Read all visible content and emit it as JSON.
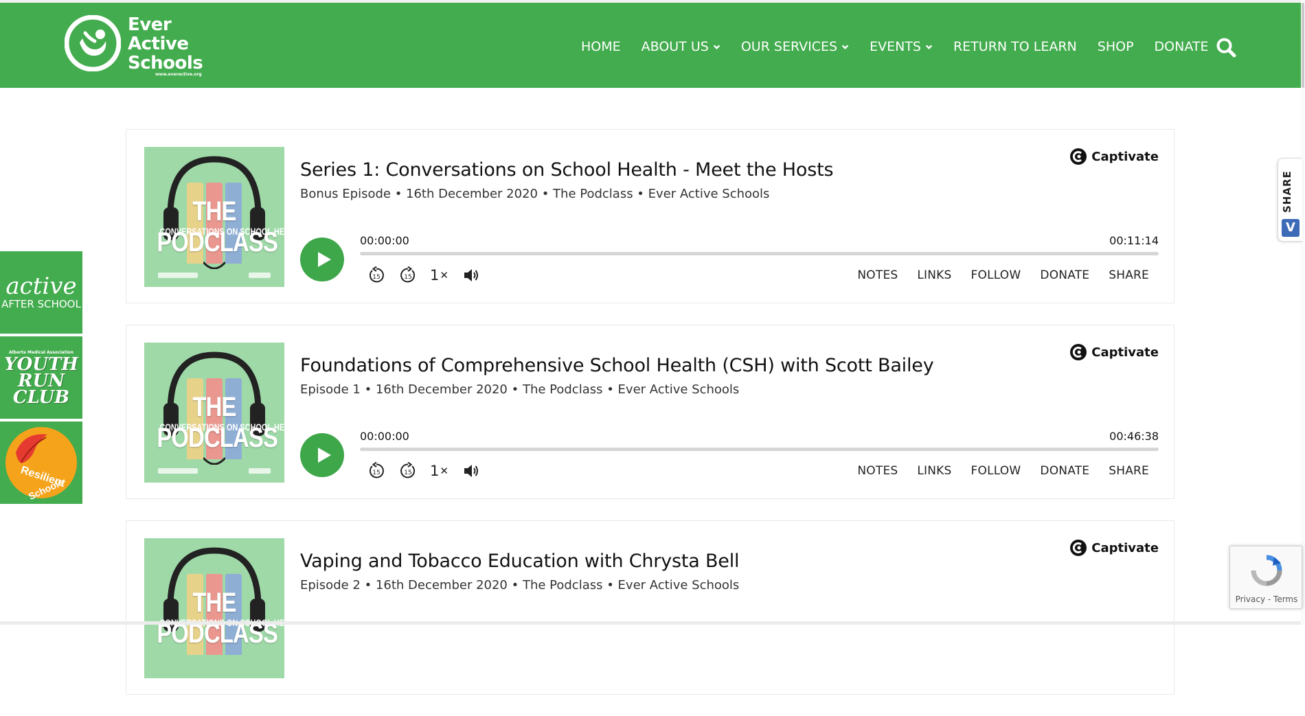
{
  "header": {
    "logo": {
      "line1": "Ever",
      "line2": "Active",
      "line3": "Schools",
      "ring_text": "Ever Active Schools",
      "url": "www.everactive.org"
    },
    "nav": [
      {
        "label": "HOME",
        "has_dropdown": false
      },
      {
        "label": "ABOUT US",
        "has_dropdown": true
      },
      {
        "label": "OUR SERVICES",
        "has_dropdown": true
      },
      {
        "label": "EVENTS",
        "has_dropdown": true
      },
      {
        "label": "RETURN TO LEARN",
        "has_dropdown": false
      },
      {
        "label": "SHOP",
        "has_dropdown": false
      },
      {
        "label": "DONATE",
        "has_dropdown": false
      }
    ],
    "search_icon": "search-icon",
    "brand_color": "#43ac4e"
  },
  "side_tiles": {
    "tile1": {
      "big": "active",
      "small": "AFTER SCHOOL"
    },
    "tile2": {
      "tiny": "Alberta Medical Association",
      "line1": "YOUTH",
      "line2": "RUN",
      "line3": "CLUB"
    },
    "tile3": {
      "text1": "Resilient",
      "text2": "Schools"
    }
  },
  "share_tab": {
    "label": "SHARE",
    "icon": "V"
  },
  "podcast": {
    "provider": "Captivate",
    "cover": {
      "title": "THE PODCLASS",
      "subtitle": "CONVERSATIONS ON SCHOOL HEALTH"
    },
    "speed": "1",
    "actions": [
      "NOTES",
      "LINKS",
      "FOLLOW",
      "DONATE",
      "SHARE"
    ]
  },
  "episodes": [
    {
      "title": "Series 1: Conversations on School Health - Meet the Hosts",
      "meta": "Bonus Episode • 16th December 2020 • The Podclass • Ever Active Schools",
      "current_time": "00:00:00",
      "duration": "00:11:14"
    },
    {
      "title": "Foundations of Comprehensive School Health (CSH) with Scott Bailey",
      "meta": "Episode 1 • 16th December 2020 • The Podclass • Ever Active Schools",
      "current_time": "00:00:00",
      "duration": "00:46:38"
    },
    {
      "title": "Vaping and Tobacco Education with Chrysta Bell",
      "meta": "Episode 2 • 16th December 2020 • The Podclass • Ever Active Schools",
      "current_time": "",
      "duration": ""
    }
  ],
  "recaptcha": {
    "privacy": "Privacy",
    "sep": " - ",
    "terms": "Terms"
  }
}
